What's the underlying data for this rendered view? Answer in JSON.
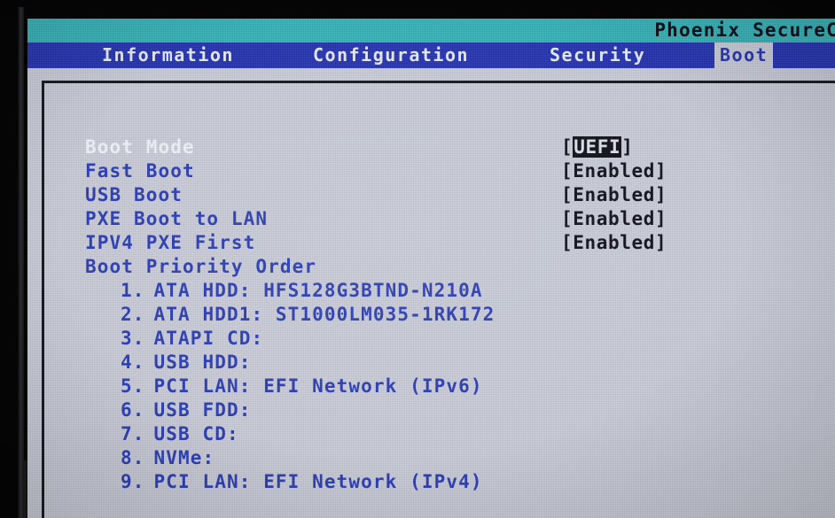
{
  "bios": {
    "brand_title": "Phoenix SecureC",
    "colors": {
      "title_band": "#35b3b8",
      "menubar": "#2433b0",
      "panel": "#c9cdd9",
      "label_blue": "#2a3cb4",
      "value_dark": "#0d0d1c",
      "highlight_text": "#f2f4fb",
      "bezel": "#050505"
    },
    "tabs": [
      {
        "label": "Information",
        "active": false
      },
      {
        "label": "Configuration",
        "active": false
      },
      {
        "label": "Security",
        "active": false
      },
      {
        "label": "Boot",
        "active": true
      }
    ],
    "settings": [
      {
        "label": "Boot Mode",
        "value": "UEFI",
        "highlighted": true,
        "selected_value": true
      },
      {
        "label": "Fast Boot",
        "value": "Enabled",
        "highlighted": false,
        "selected_value": false
      },
      {
        "label": "USB Boot",
        "value": "Enabled",
        "highlighted": false,
        "selected_value": false
      },
      {
        "label": "PXE Boot to LAN",
        "value": "Enabled",
        "highlighted": false,
        "selected_value": false
      },
      {
        "label": "IPV4 PXE First",
        "value": "Enabled",
        "highlighted": false,
        "selected_value": false
      },
      {
        "label": "Boot Priority Order",
        "value": "",
        "highlighted": false,
        "selected_value": false
      }
    ],
    "boot_priority": [
      {
        "num": "1.",
        "text": "ATA HDD: HFS128G3BTND-N210A"
      },
      {
        "num": "2.",
        "text": "ATA HDD1: ST1000LM035-1RK172"
      },
      {
        "num": "3.",
        "text": "ATAPI CD:"
      },
      {
        "num": "4.",
        "text": "USB HDD:"
      },
      {
        "num": "5.",
        "text": "PCI LAN: EFI Network (IPv6)"
      },
      {
        "num": "6.",
        "text": "USB FDD:"
      },
      {
        "num": "7.",
        "text": "USB CD:"
      },
      {
        "num": "8.",
        "text": "NVMe:"
      },
      {
        "num": "9.",
        "text": "PCI LAN: EFI Network (IPv4)"
      }
    ]
  }
}
